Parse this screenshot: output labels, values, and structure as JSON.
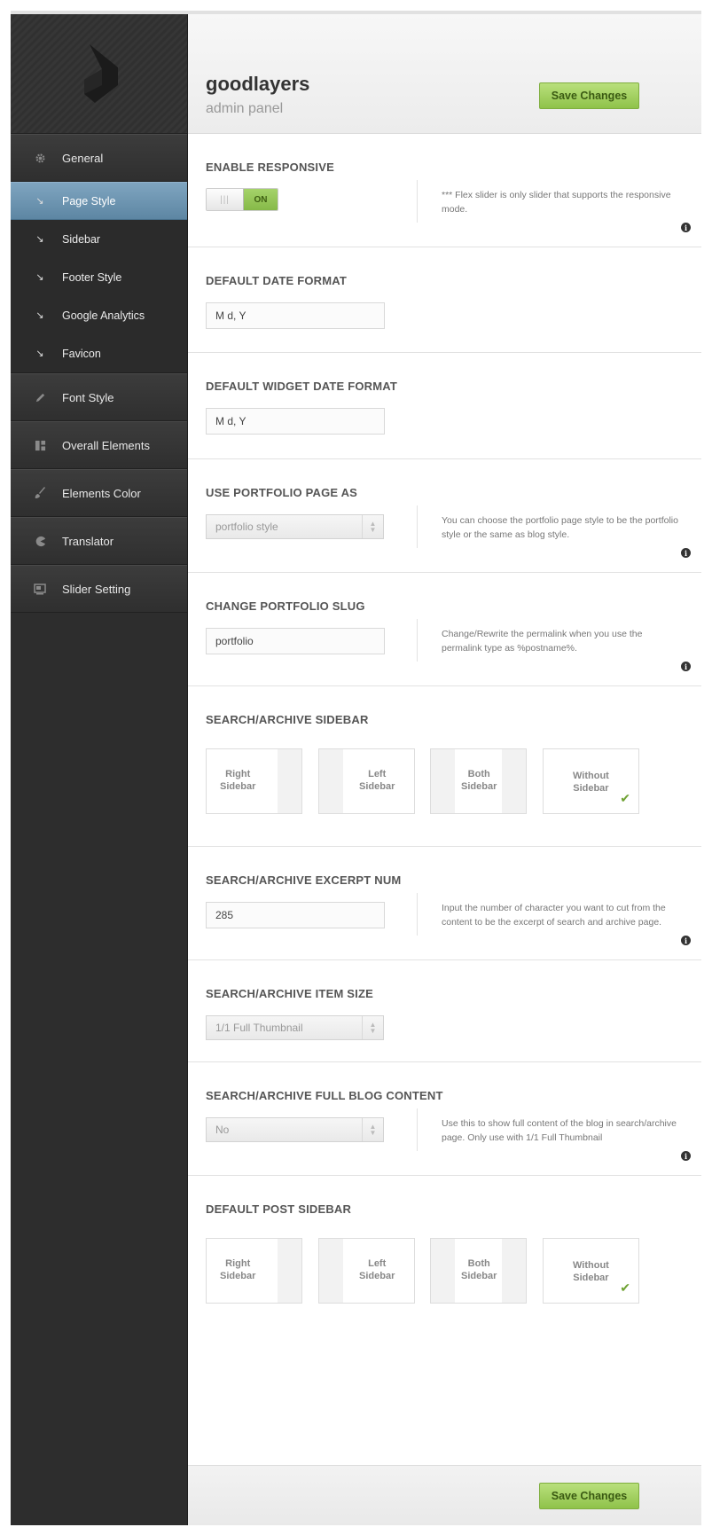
{
  "header": {
    "brand": "goodlayers",
    "subtitle": "admin panel",
    "save_label": "Save Changes"
  },
  "sidebar": {
    "items": [
      {
        "label": "General",
        "icon": "gear-icon"
      },
      {
        "label": "Font Style",
        "icon": "pencil-icon"
      },
      {
        "label": "Overall Elements",
        "icon": "layout-icon"
      },
      {
        "label": "Elements Color",
        "icon": "brush-icon"
      },
      {
        "label": "Translator",
        "icon": "pacman-icon"
      },
      {
        "label": "Slider Setting",
        "icon": "slides-icon"
      }
    ],
    "sub_items": [
      {
        "label": "Page Style",
        "active": true
      },
      {
        "label": "Sidebar"
      },
      {
        "label": "Footer Style"
      },
      {
        "label": "Google Analytics"
      },
      {
        "label": "Favicon"
      }
    ]
  },
  "sections": {
    "responsive": {
      "title": "ENABLE RESPONSIVE",
      "toggle_on": "ON",
      "toggle_state": true,
      "desc": "*** Flex slider is only slider that supports the responsive mode."
    },
    "date_format": {
      "title": "DEFAULT DATE FORMAT",
      "value": "M d, Y"
    },
    "widget_date_format": {
      "title": "DEFAULT WIDGET DATE FORMAT",
      "value": "M d, Y"
    },
    "portfolio_page": {
      "title": "USE PORTFOLIO PAGE AS",
      "value": "portfolio style",
      "desc": "You can choose the portfolio page style to be the portfolio style or the same as blog style."
    },
    "portfolio_slug": {
      "title": "CHANGE PORTFOLIO SLUG",
      "value": "portfolio",
      "desc": "Change/Rewrite the permalink when you use the permalink type as %postname%."
    },
    "search_sidebar": {
      "title": "SEARCH/ARCHIVE SIDEBAR",
      "selected": "Without Sidebar"
    },
    "excerpt_num": {
      "title": "SEARCH/ARCHIVE EXCERPT NUM",
      "value": "285",
      "desc": "Input the number of character you want to cut from the content to be the excerpt of search and archive page."
    },
    "item_size": {
      "title": "SEARCH/ARCHIVE ITEM SIZE",
      "value": "1/1 Full Thumbnail"
    },
    "full_blog": {
      "title": "SEARCH/ARCHIVE FULL BLOG CONTENT",
      "value": "No",
      "desc": "Use this to show full content of the blog in search/archive page. Only use with 1/1 Full Thumbnail"
    },
    "post_sidebar": {
      "title": "DEFAULT POST SIDEBAR",
      "selected": "Without Sidebar"
    }
  },
  "sidebar_layouts": [
    {
      "line1": "Right",
      "line2": "Sidebar"
    },
    {
      "line1": "Left",
      "line2": "Sidebar"
    },
    {
      "line1": "Both",
      "line2": "Sidebar"
    },
    {
      "line1": "Without",
      "line2": "Sidebar"
    }
  ],
  "footer": {
    "save_label": "Save Changes"
  }
}
